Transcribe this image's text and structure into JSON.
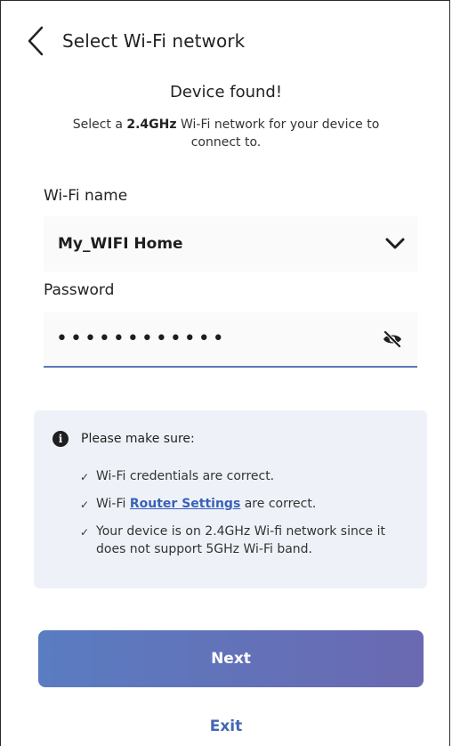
{
  "header": {
    "title": "Select Wi-Fi network"
  },
  "intro": {
    "title": "Device found!",
    "subtitle_prefix": "Select a ",
    "subtitle_band": "2.4GHz",
    "subtitle_suffix": " Wi-Fi network for your device to connect to."
  },
  "wifi": {
    "label": "Wi-Fi name",
    "value": "My_WIFI Home"
  },
  "password": {
    "label": "Password",
    "masked_value": "••••••••••••"
  },
  "notice": {
    "title": "Please make sure:",
    "items": [
      {
        "text": "Wi-Fi credentials are correct."
      },
      {
        "prefix": "Wi-Fi ",
        "link": "Router Settings",
        "suffix": " are correct."
      },
      {
        "text": "Your device is on 2.4GHz Wi-fi network since it does not support 5GHz Wi-Fi band."
      }
    ]
  },
  "actions": {
    "next_label": "Next",
    "exit_label": "Exit"
  },
  "icons": {
    "back": "chevron-left-icon",
    "dropdown": "chevron-down-icon",
    "eye": "eye-off-icon",
    "info": "info-icon"
  },
  "colors": {
    "accent": "#4466b3",
    "button_start": "#5a7cc1",
    "button_end": "#6a69b1",
    "notice_bg": "#eef2f8"
  }
}
